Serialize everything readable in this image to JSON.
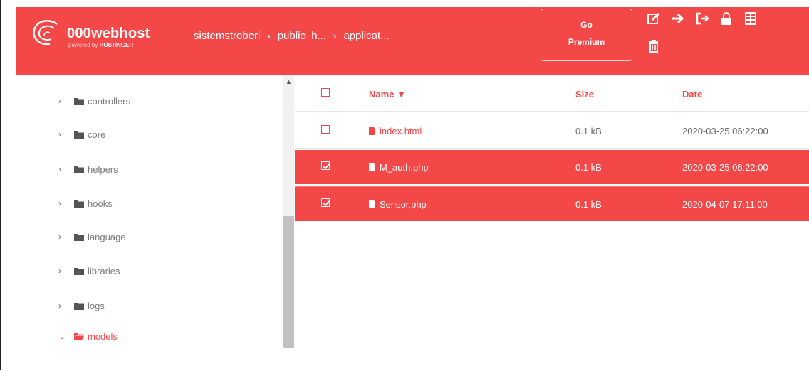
{
  "header": {
    "logo": {
      "name": "000webhost",
      "powered_by": "powered by",
      "brand": "HOSTINGER"
    },
    "breadcrumb": [
      "sistemstroberi",
      "public_h...",
      "applicat..."
    ],
    "go_premium": {
      "line1": "Go",
      "line2": "Premium"
    },
    "icons": [
      "edit-icon",
      "arrow-right-icon",
      "sign-out-icon",
      "lock-icon",
      "database-icon",
      "trash-icon"
    ]
  },
  "sidebar": {
    "items": [
      {
        "label": "controllers",
        "state": "collapsed"
      },
      {
        "label": "core",
        "state": "collapsed"
      },
      {
        "label": "helpers",
        "state": "collapsed"
      },
      {
        "label": "hooks",
        "state": "collapsed"
      },
      {
        "label": "language",
        "state": "collapsed"
      },
      {
        "label": "libraries",
        "state": "collapsed"
      },
      {
        "label": "logs",
        "state": "collapsed"
      },
      {
        "label": "models",
        "state": "expanded"
      }
    ]
  },
  "table": {
    "headers": {
      "name": "Name ▼",
      "size": "Size",
      "date": "Date"
    },
    "rows": [
      {
        "name": "index.html",
        "size": "0.1 kB",
        "date": "2020-03-25 06:22:00",
        "checked": false
      },
      {
        "name": "M_auth.php",
        "size": "0.1 kB",
        "date": "2020-03-25 06:22:00",
        "checked": true
      },
      {
        "name": "Sensor.php",
        "size": "0.1 kB",
        "date": "2020-04-07 17:11:00",
        "checked": true
      }
    ]
  },
  "colors": {
    "accent": "#f44848",
    "text_muted": "#7b7b7b"
  }
}
